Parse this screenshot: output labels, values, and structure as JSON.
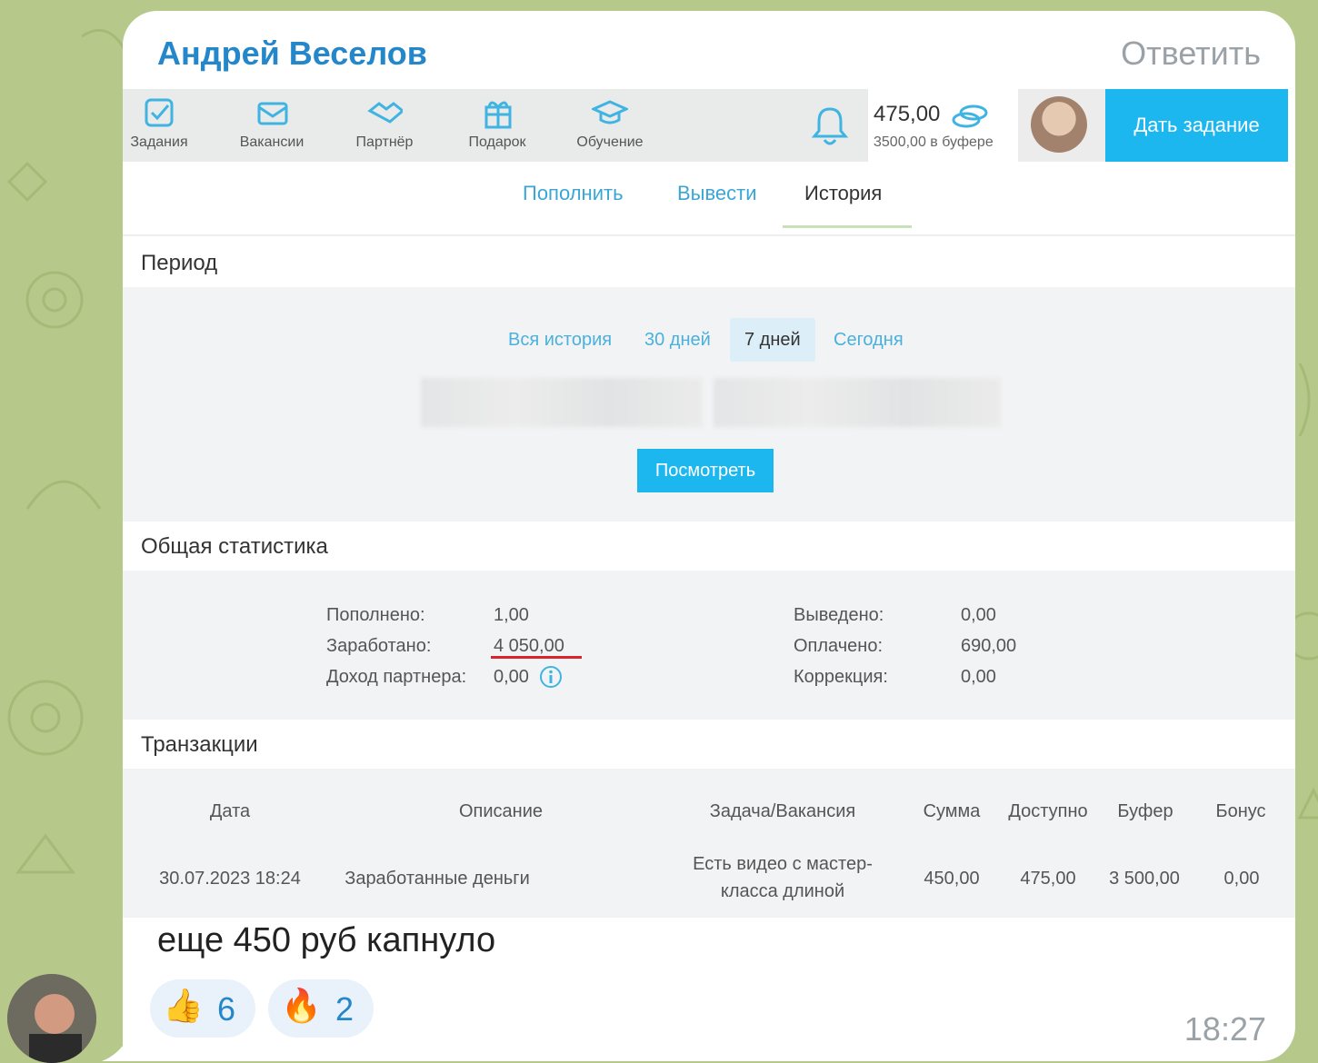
{
  "message": {
    "sender": "Андрей Веселов",
    "reply_label": "Ответить",
    "text": "еще 450 руб капнуло",
    "time": "18:27",
    "reactions": [
      {
        "emoji": "👍",
        "count": "6"
      },
      {
        "emoji": "🔥",
        "count": "2"
      }
    ]
  },
  "site": {
    "nav": [
      {
        "label": "Задания",
        "icon": "tasks-icon"
      },
      {
        "label": "Вакансии",
        "icon": "envelope-icon"
      },
      {
        "label": "Партнёр",
        "icon": "handshake-icon"
      },
      {
        "label": "Подарок",
        "icon": "gift-icon"
      },
      {
        "label": "Обучение",
        "icon": "graduation-cap-icon"
      }
    ],
    "balance": {
      "amount": "475,00",
      "buffer": "3500,00 в буфере"
    },
    "give_task": "Дать задание",
    "tabs": [
      {
        "label": "Пополнить"
      },
      {
        "label": "Вывести"
      },
      {
        "label": "История"
      }
    ],
    "period": {
      "title": "Период",
      "buttons": [
        {
          "label": "Вся история"
        },
        {
          "label": "30 дней"
        },
        {
          "label": "7 дней"
        },
        {
          "label": "Сегодня"
        }
      ],
      "view_button": "Посмотреть"
    },
    "stats": {
      "title": "Общая статистика",
      "left": [
        {
          "label": "Пополнено:",
          "value": "1,00"
        },
        {
          "label": "Заработано:",
          "value": "4 050,00"
        },
        {
          "label": "Доход партнера:",
          "value": "0,00"
        }
      ],
      "right": [
        {
          "label": "Выведено:",
          "value": "0,00"
        },
        {
          "label": "Оплачено:",
          "value": "690,00"
        },
        {
          "label": "Коррекция:",
          "value": "0,00"
        }
      ]
    },
    "transactions": {
      "title": "Транзакции",
      "headers": [
        "Дата",
        "Описание",
        "Задача/Вакансия",
        "Сумма",
        "Доступно",
        "Буфер",
        "Бонус"
      ],
      "rows": [
        {
          "date": "30.07.2023 18:24",
          "description": "Заработанные деньги",
          "task_line1": "Есть видео с мастер-",
          "task_line2": "класса длиной",
          "sum": "450,00",
          "available": "475,00",
          "buffer": "3 500,00",
          "bonus": "0,00"
        }
      ]
    }
  },
  "colors": {
    "accent": "#1db7ef",
    "link": "#3aa6d6",
    "sender": "#2487c9",
    "highlight": "#d9232d"
  }
}
